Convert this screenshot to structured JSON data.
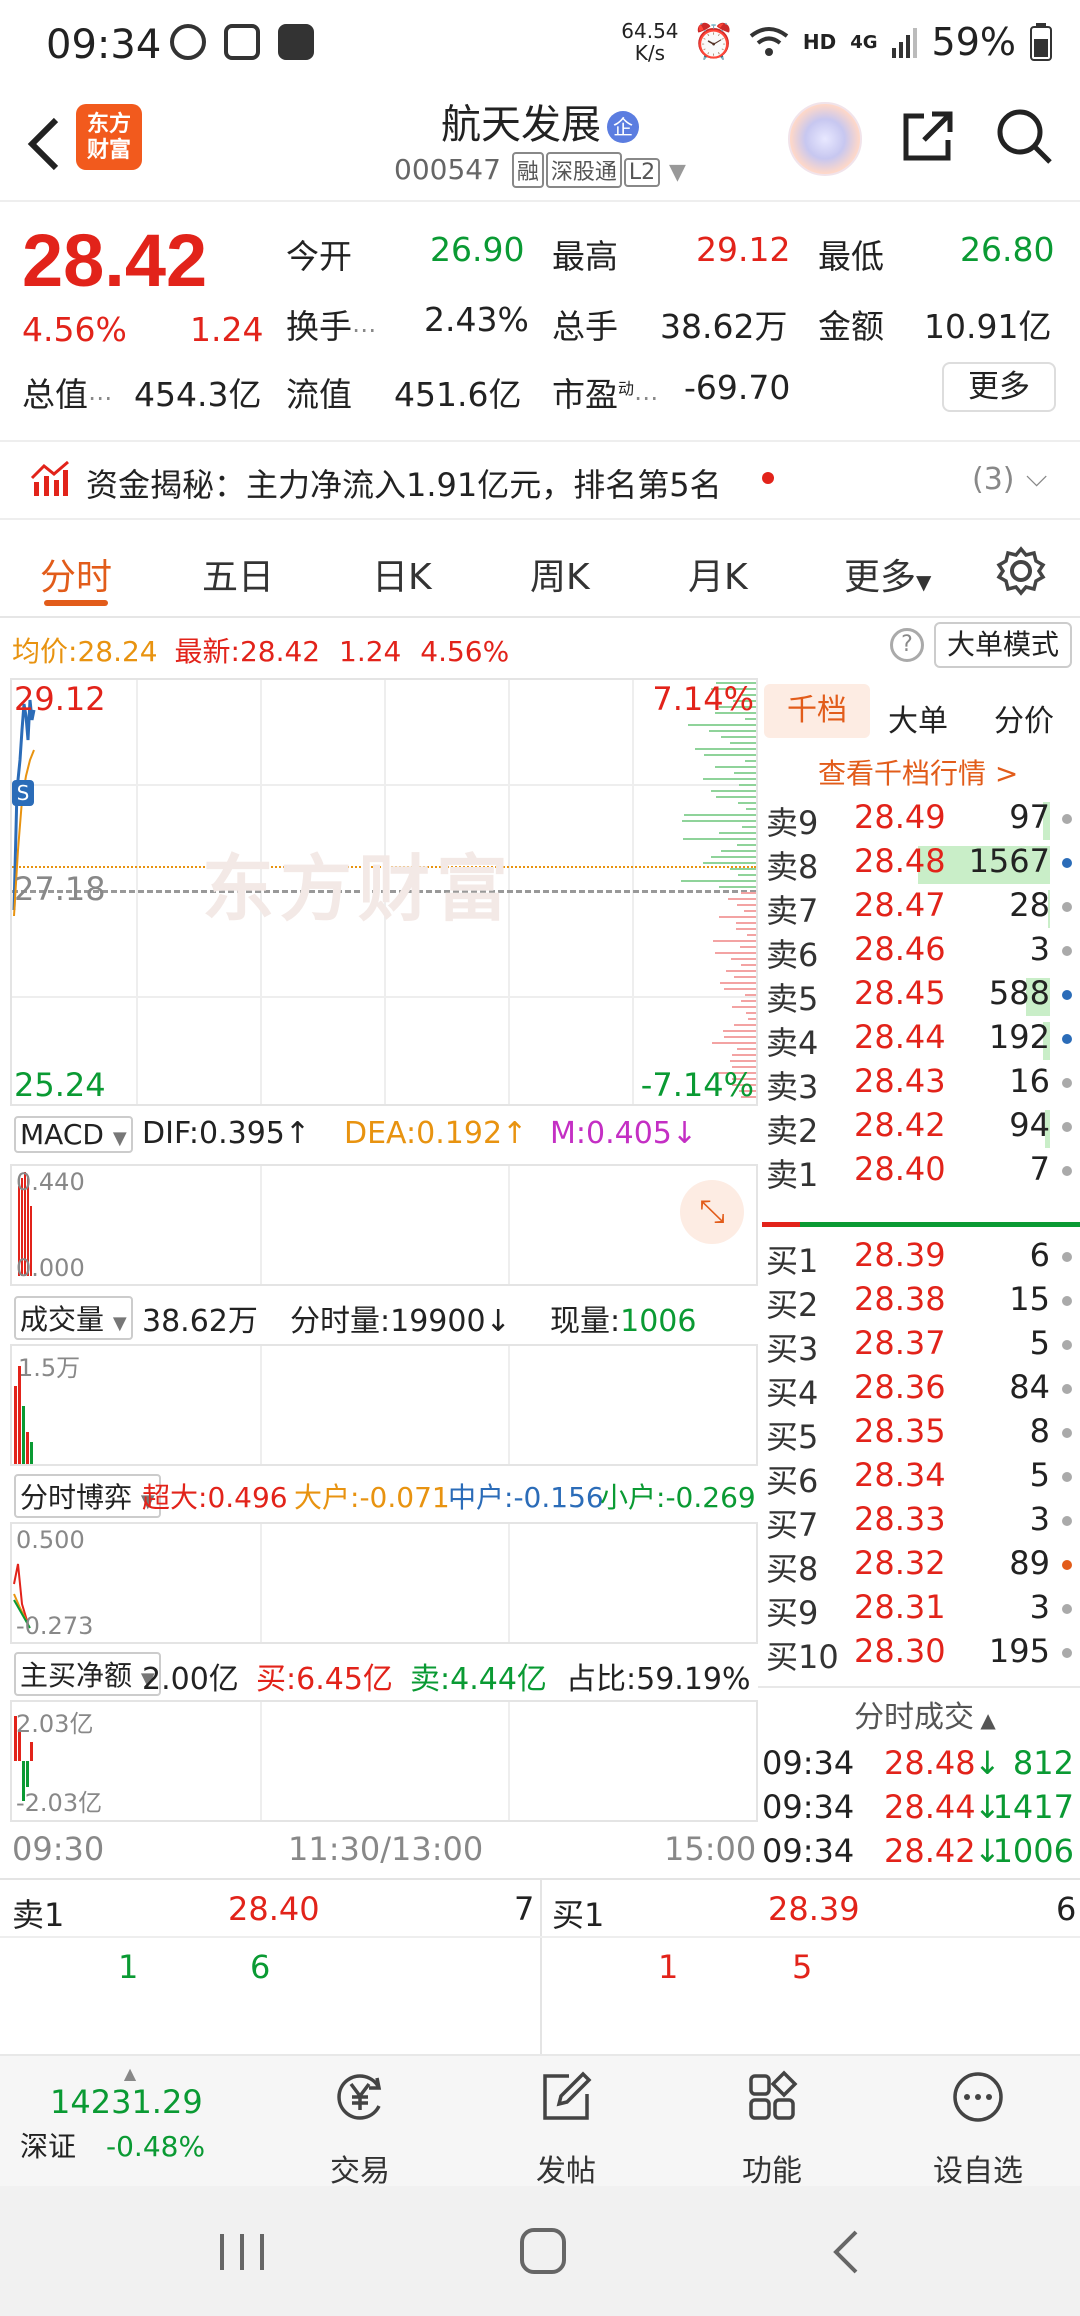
{
  "status": {
    "time": "09:34",
    "net_speed_top": "64.54",
    "net_speed_bottom": "K/s",
    "hd": "HD",
    "net_type": "4G",
    "battery": "59%"
  },
  "header": {
    "logo_line1": "东方",
    "logo_line2": "财富",
    "name": "航天发展",
    "badge": "企",
    "code": "000547",
    "tags": [
      "融",
      "深股通",
      "L2"
    ]
  },
  "quote": {
    "price": "28.42",
    "pct": "4.56%",
    "change": "1.24",
    "open_label": "今开",
    "open": "26.90",
    "high_label": "最高",
    "high": "29.12",
    "low_label": "最低",
    "low": "26.80",
    "turnover_label": "换手",
    "turnover": "2.43%",
    "volume_label": "总手",
    "volume": "38.62万",
    "amount_label": "金额",
    "amount": "10.91亿",
    "mcap_label": "总值",
    "mcap": "454.3亿",
    "float_label": "流值",
    "float": "451.6亿",
    "pe_label": "市盈",
    "pe_sup": "动",
    "pe": "-69.70",
    "more_button": "更多"
  },
  "fund": {
    "text": "资金揭秘：主力净流入1.91亿元，排名第5名",
    "count": "(3)"
  },
  "tabs": [
    "分时",
    "五日",
    "日K",
    "周K",
    "月K",
    "更多"
  ],
  "infoline": {
    "avg_label": "均价:",
    "avg": "28.24",
    "last_label": "最新:",
    "last": "28.42",
    "chg": "1.24",
    "pct": "4.56%",
    "mode_button": "大单模式"
  },
  "chart": {
    "max_price": "29.12",
    "max_pct": "7.14%",
    "mid_price": "27.18",
    "min_price": "25.24",
    "min_pct": "-7.14%",
    "watermark": "东方财富",
    "s_marker": "S"
  },
  "macd": {
    "name": "MACD",
    "dif": "DIF:0.395↑",
    "dea": "DEA:0.192↑",
    "m": "M:0.405↓",
    "top": "0.440",
    "bottom": "0.000"
  },
  "vol": {
    "name": "成交量",
    "total": "38.62万",
    "minute": "分时量:19900↓",
    "now_label": "现量:",
    "now": "1006",
    "top": "1.5万"
  },
  "game": {
    "name": "分时博弈",
    "super_label": "超大:",
    "super": "0.496",
    "big_label": "大户:",
    "big": "-0.071",
    "mid_label": "中户:",
    "mid": "-0.156",
    "small_label": "小户:",
    "small": "-0.269",
    "top": "0.500",
    "bottom": "-0.273"
  },
  "netbuy": {
    "name": "主买净额",
    "value": "2.00亿",
    "buy_label": "买:",
    "buy": "6.45亿",
    "sell_label": "卖:",
    "sell": "4.44亿",
    "ratio": "占比:59.19%",
    "top": "2.03亿",
    "bottom": "-2.03亿"
  },
  "time_axis": [
    "09:30",
    "11:30/13:00",
    "15:00"
  ],
  "book": {
    "tabs": [
      "千档",
      "大单",
      "分价"
    ],
    "view_link": "查看千档行情 >",
    "asks": [
      {
        "label": "卖9",
        "price": "28.49",
        "vol": "97",
        "dot": "#aaaaaa",
        "fill": 0.03
      },
      {
        "label": "卖8",
        "price": "28.48",
        "vol": "1567",
        "dot": "#2b6cb8",
        "fill": 0.55
      },
      {
        "label": "卖7",
        "price": "28.47",
        "vol": "28",
        "dot": "#aaaaaa",
        "fill": 0.01
      },
      {
        "label": "卖6",
        "price": "28.46",
        "vol": "3",
        "dot": "#aaaaaa",
        "fill": 0.0
      },
      {
        "label": "卖5",
        "price": "28.45",
        "vol": "588",
        "dot": "#2b6cb8",
        "fill": 0.1
      },
      {
        "label": "卖4",
        "price": "28.44",
        "vol": "192",
        "dot": "#2b6cb8",
        "fill": 0.03
      },
      {
        "label": "卖3",
        "price": "28.43",
        "vol": "16",
        "dot": "#aaaaaa",
        "fill": 0.0
      },
      {
        "label": "卖2",
        "price": "28.42",
        "vol": "94",
        "dot": "#aaaaaa",
        "fill": 0.02
      },
      {
        "label": "卖1",
        "price": "28.40",
        "vol": "7",
        "dot": "#aaaaaa",
        "fill": 0.0
      }
    ],
    "bids": [
      {
        "label": "买1",
        "price": "28.39",
        "vol": "6",
        "dot": "#aaaaaa"
      },
      {
        "label": "买2",
        "price": "28.38",
        "vol": "15",
        "dot": "#aaaaaa"
      },
      {
        "label": "买3",
        "price": "28.37",
        "vol": "5",
        "dot": "#aaaaaa"
      },
      {
        "label": "买4",
        "price": "28.36",
        "vol": "84",
        "dot": "#aaaaaa"
      },
      {
        "label": "买5",
        "price": "28.35",
        "vol": "8",
        "dot": "#aaaaaa"
      },
      {
        "label": "买6",
        "price": "28.34",
        "vol": "5",
        "dot": "#aaaaaa"
      },
      {
        "label": "买7",
        "price": "28.33",
        "vol": "3",
        "dot": "#aaaaaa"
      },
      {
        "label": "买8",
        "price": "28.32",
        "vol": "89",
        "dot": "#e25c1a"
      },
      {
        "label": "买9",
        "price": "28.31",
        "vol": "3",
        "dot": "#aaaaaa"
      },
      {
        "label": "买10",
        "price": "28.30",
        "vol": "195",
        "dot": "#aaaaaa"
      }
    ],
    "ticks_title": "分时成交",
    "ticks": [
      {
        "time": "09:34",
        "price": "28.48",
        "arrow": "↓",
        "vol": "812"
      },
      {
        "time": "09:34",
        "price": "28.44",
        "arrow": "↓",
        "vol": "1417"
      },
      {
        "time": "09:34",
        "price": "28.42",
        "arrow": "↓",
        "vol": "1006"
      }
    ]
  },
  "bottom_quote": {
    "left": {
      "label": "卖1",
      "price": "28.40",
      "vol": "7",
      "a": "1",
      "b": "6"
    },
    "right": {
      "label": "买1",
      "price": "28.39",
      "vol": "6",
      "a": "1",
      "b": "5"
    }
  },
  "nav": {
    "index_value": "14231.29",
    "index_name": "深证",
    "index_pct": "-0.48%",
    "items": [
      "交易",
      "发帖",
      "功能",
      "设自选"
    ]
  },
  "colors": {
    "up": "#e2231a",
    "down": "#0a9a33",
    "accent": "#e25c1a"
  }
}
